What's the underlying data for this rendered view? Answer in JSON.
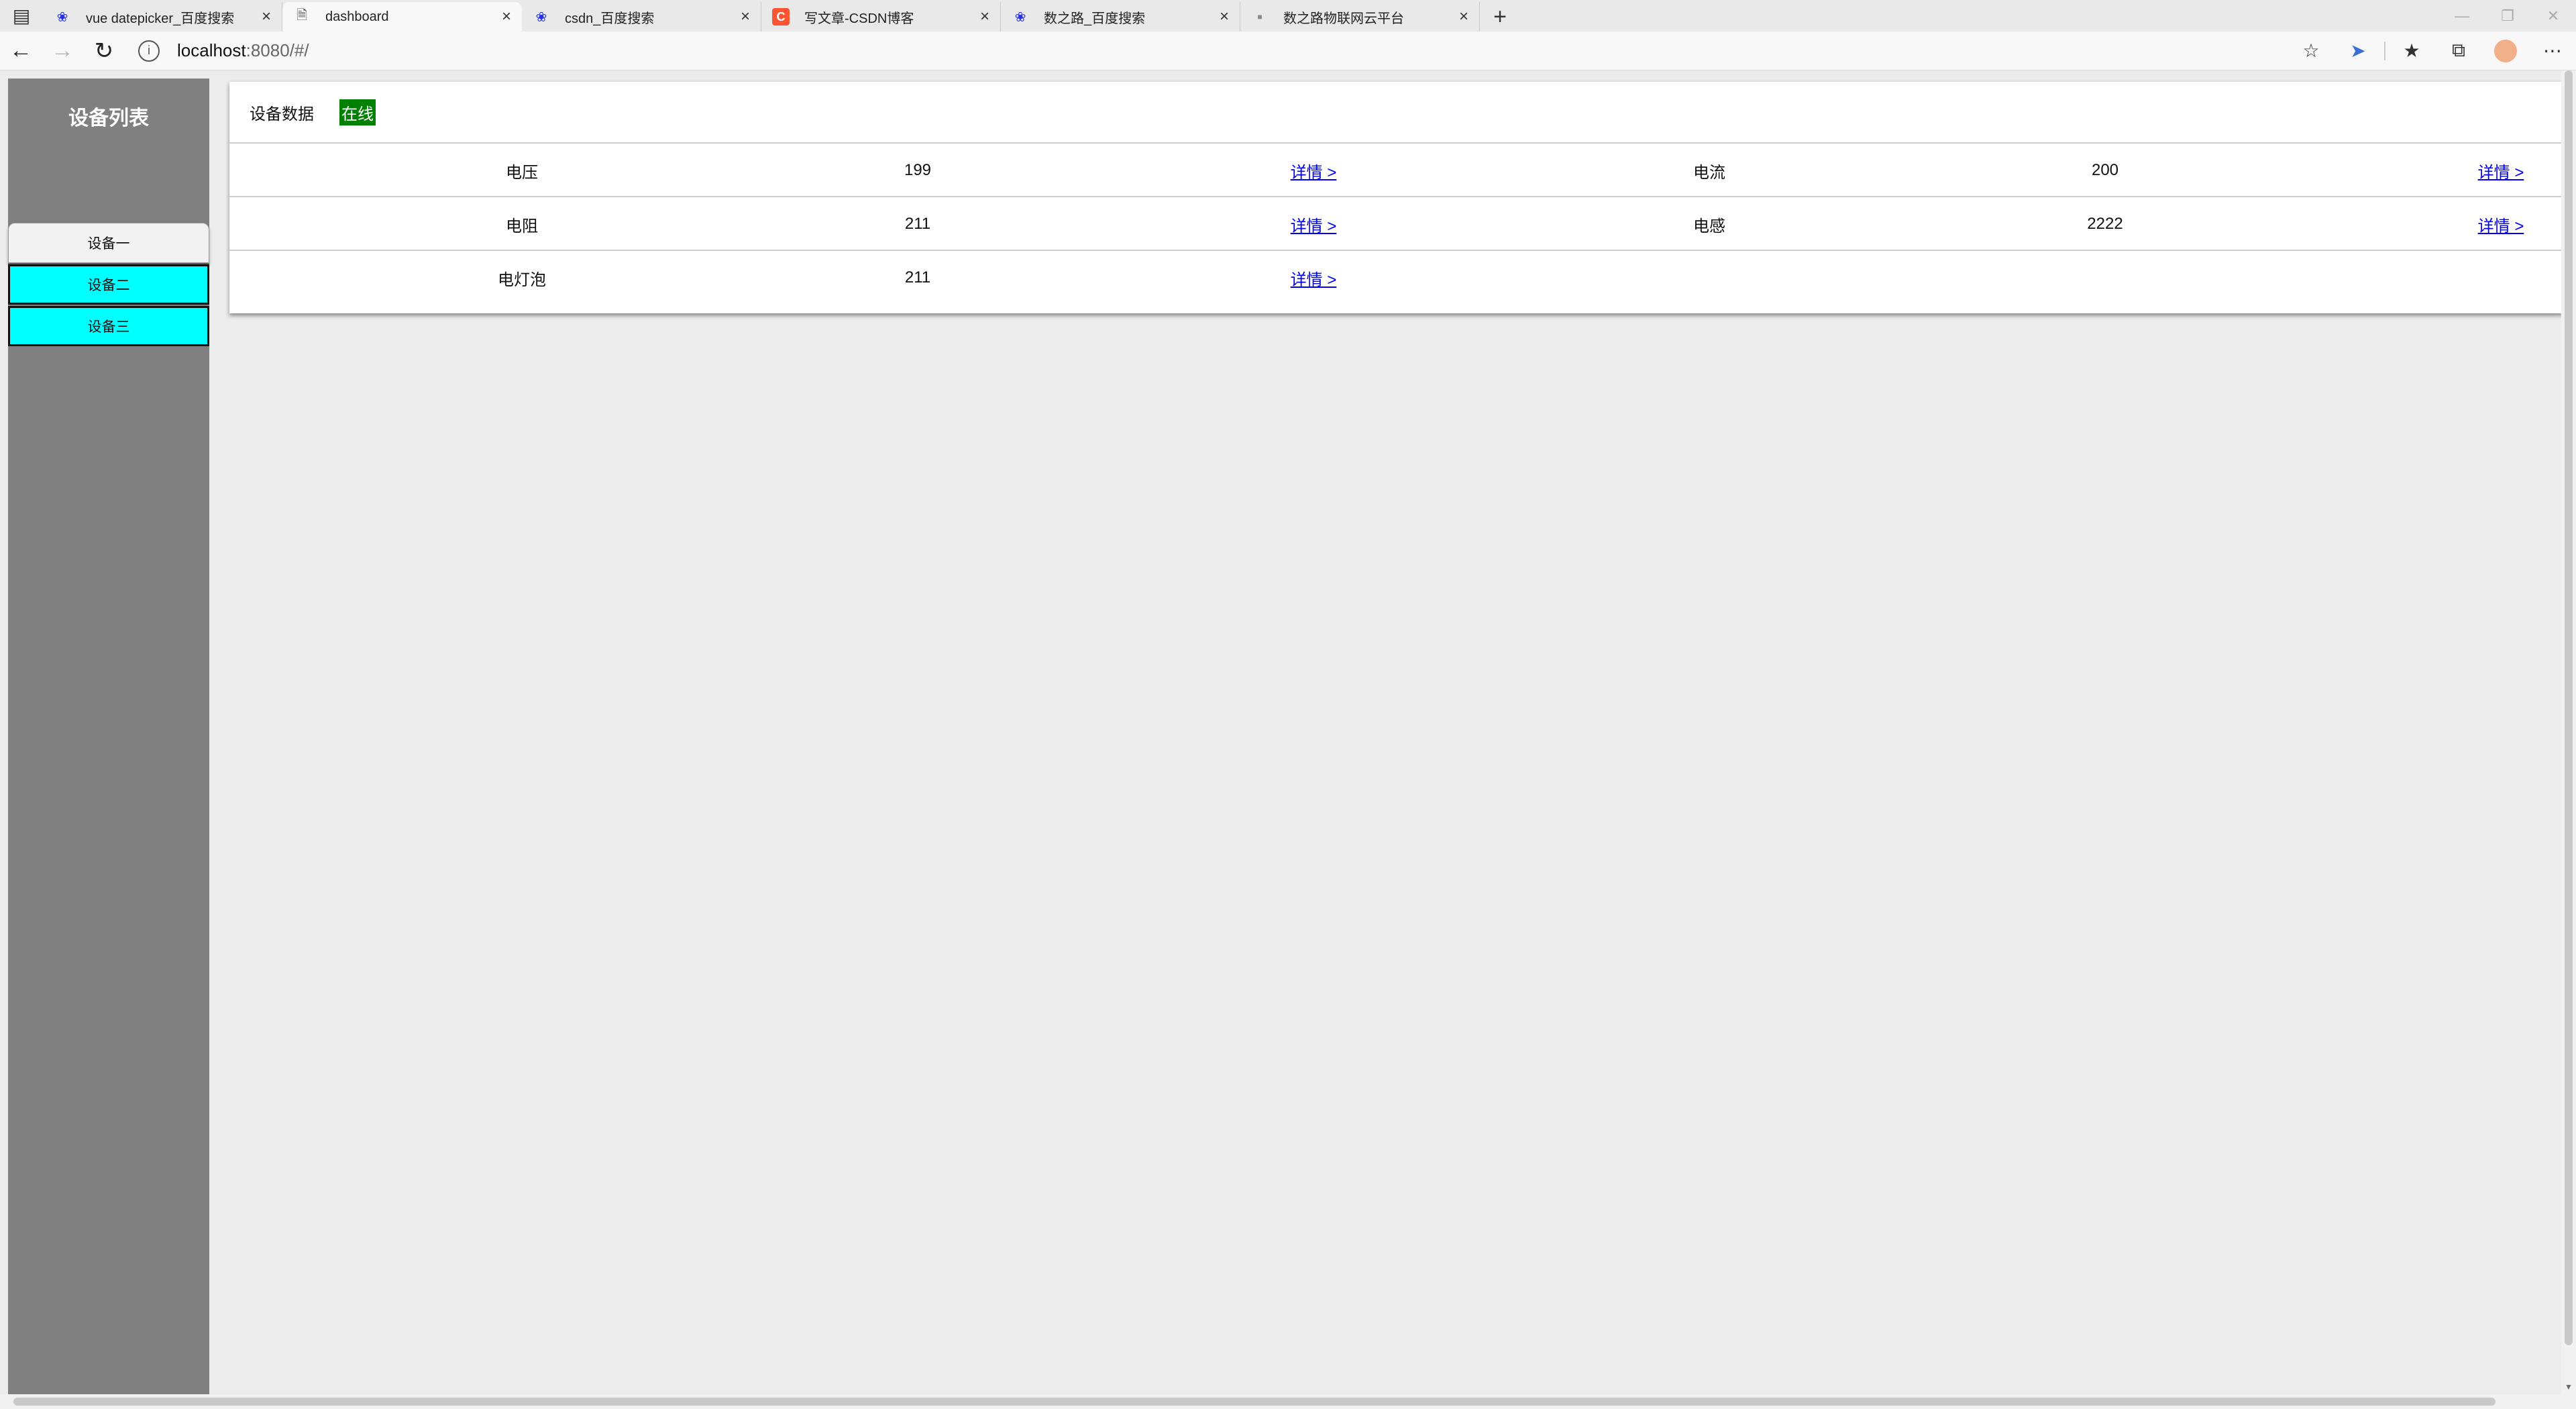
{
  "browser": {
    "tabs": [
      {
        "title": "vue datepicker_百度搜索",
        "icon": "baidu-paw-icon"
      },
      {
        "title": "dashboard",
        "icon": "page-icon",
        "active": true
      },
      {
        "title": "csdn_百度搜索",
        "icon": "baidu-paw-icon"
      },
      {
        "title": "写文章-CSDN博客",
        "icon": "csdn-icon",
        "icon_glyph": "C"
      },
      {
        "title": "数之路_百度搜索",
        "icon": "baidu-paw-icon"
      },
      {
        "title": "数之路物联网云平台",
        "icon": "iot-icon"
      }
    ],
    "address": {
      "host": "localhost",
      "path": ":8080/#/"
    }
  },
  "sidebar": {
    "title": "设备列表",
    "devices": [
      {
        "label": "设备一",
        "selected": true
      },
      {
        "label": "设备二",
        "selected": false
      },
      {
        "label": "设备三",
        "selected": false
      }
    ]
  },
  "card": {
    "title": "设备数据",
    "status": "在线",
    "status_color": "#008000",
    "rows": [
      [
        {
          "name": "电压",
          "value": "199",
          "link": "详情 >"
        },
        {
          "name": "电流",
          "value": "200",
          "link": "详情 >"
        }
      ],
      [
        {
          "name": "电阻",
          "value": "211",
          "link": "详情 >"
        },
        {
          "name": "电感",
          "value": "2222",
          "link": "详情 >"
        }
      ],
      [
        {
          "name": "电灯泡",
          "value": "211",
          "link": "详情 >"
        }
      ]
    ]
  },
  "colors": {
    "sidebar_bg": "#808080",
    "device_bg": "#00ffff",
    "page_bg": "#ececec",
    "link": "#0000ee"
  }
}
